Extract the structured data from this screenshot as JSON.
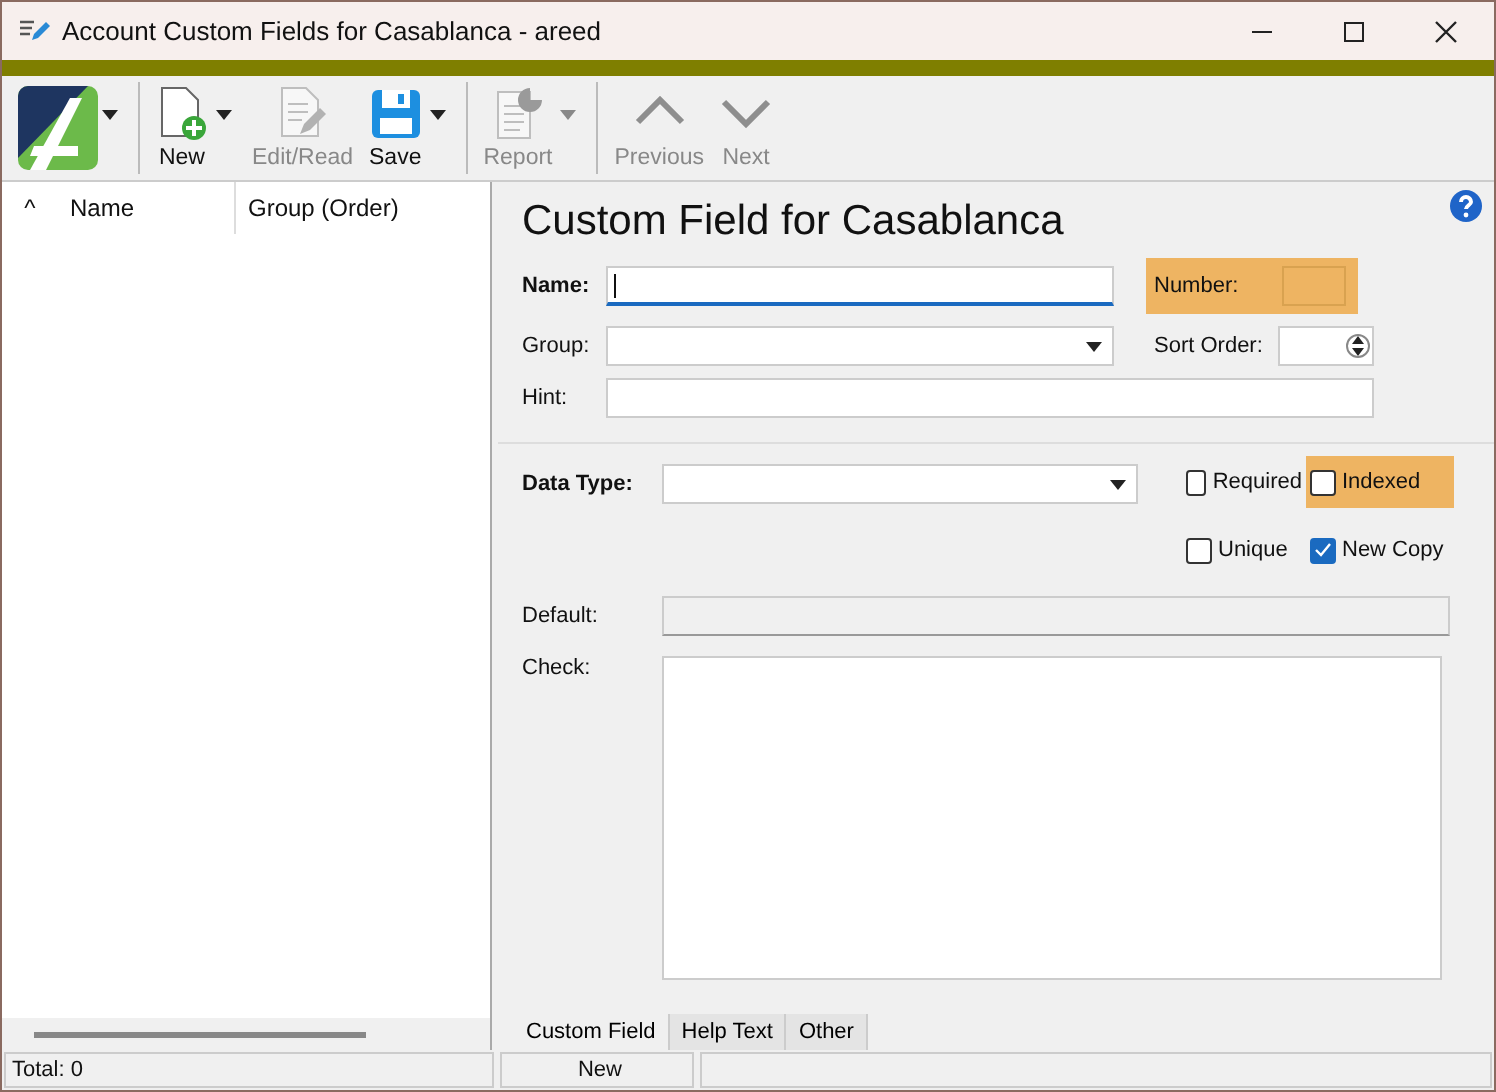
{
  "window": {
    "title": "Account Custom Fields for Casablanca - areed"
  },
  "toolbar": {
    "buttons": [
      {
        "kind": "logo",
        "dropdown": true
      },
      {
        "kind": "new",
        "label": "New",
        "disabled": false,
        "dropdown": true
      },
      {
        "kind": "edit",
        "label": "Edit/Read",
        "disabled": true,
        "dropdown": false
      },
      {
        "kind": "save",
        "label": "Save",
        "disabled": false,
        "dropdown": true
      },
      {
        "kind": "report",
        "label": "Report",
        "disabled": true,
        "dropdown": true
      },
      {
        "kind": "previous",
        "label": "Previous",
        "disabled": true,
        "dropdown": false
      },
      {
        "kind": "next",
        "label": "Next",
        "disabled": true,
        "dropdown": false
      }
    ]
  },
  "list": {
    "sort_indicator": "^",
    "columns": [
      "Name",
      "Group (Order)"
    ]
  },
  "form": {
    "heading": "Custom Field for Casablanca",
    "name": {
      "label": "Name:",
      "highlighted": false
    },
    "number": {
      "label": "Number:",
      "highlighted": true
    },
    "group": {
      "label": "Group:"
    },
    "sort_order": {
      "label": "Sort Order:"
    },
    "hint": {
      "label": "Hint:"
    },
    "data_type": {
      "label": "Data Type:"
    },
    "options": [
      {
        "label": "Required",
        "checked": false,
        "highlighted": false
      },
      {
        "label": "Indexed",
        "checked": false,
        "highlighted": true
      },
      {
        "label": "Unique",
        "checked": false,
        "highlighted": false
      },
      {
        "label": "New Copy",
        "checked": true,
        "highlighted": false
      }
    ],
    "default": {
      "label": "Default:",
      "disabled": true
    },
    "check": {
      "label": "Check:"
    }
  },
  "tabs": [
    {
      "label": "Custom Field",
      "selected": true
    },
    {
      "label": "Help Text",
      "selected": false
    },
    {
      "label": "Other",
      "selected": false
    }
  ],
  "status_bar": {
    "total": "Total: 0",
    "mode": "New"
  }
}
